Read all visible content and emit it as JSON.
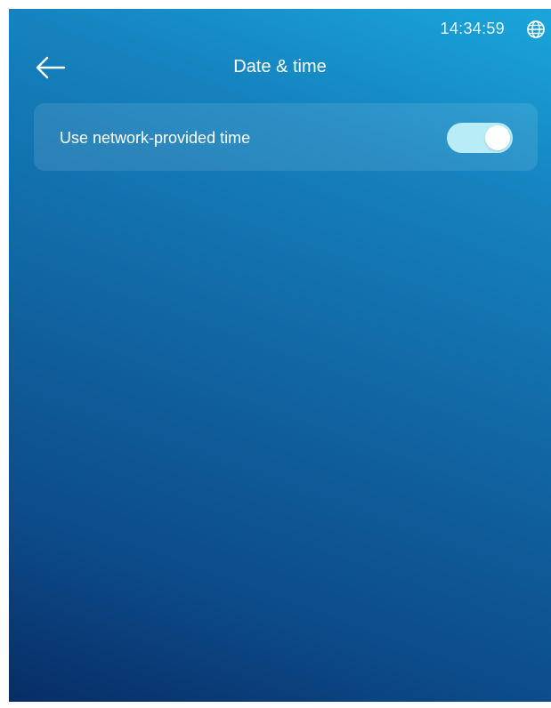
{
  "status_bar": {
    "time": "14:34:59",
    "icon": "globe-icon"
  },
  "header": {
    "back_icon": "arrow-left-icon",
    "title": "Date & time"
  },
  "settings": {
    "network_time": {
      "label": "Use network-provided time",
      "enabled": true
    }
  },
  "colors": {
    "gradient_top": "#1aa6da",
    "gradient_bottom": "#072d66",
    "toggle_on": "#b8ecf7"
  }
}
